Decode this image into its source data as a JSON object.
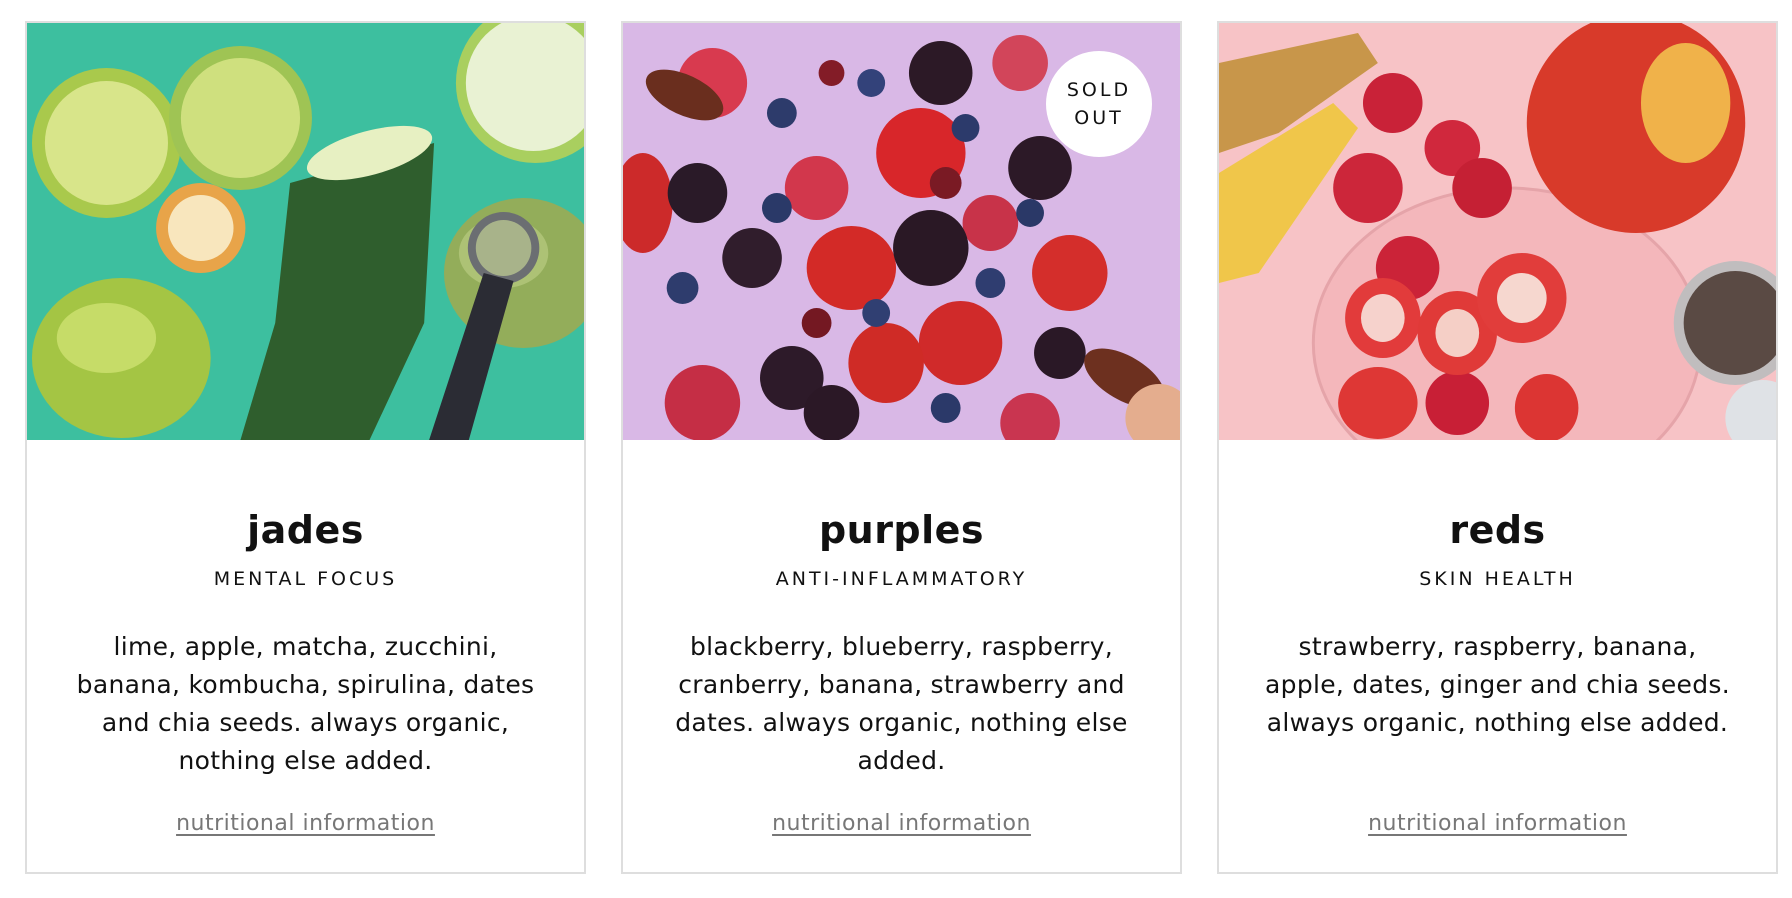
{
  "products": [
    {
      "name": "jades",
      "benefit": "MENTAL FOCUS",
      "ingredients": "lime, apple, matcha, zucchini, banana, kombucha, spirulina, dates and chia seeds. always organic, nothing else added.",
      "link": "nutritional information",
      "bg_color": "#3dbf9f"
    },
    {
      "name": "purples",
      "benefit": "ANTI-INFLAMMATORY",
      "ingredients": "blackberry, blueberry, raspberry, cranberry, banana, strawberry and dates. always organic, nothing else added.",
      "link": "nutritional information",
      "badge": "SOLD\nOUT",
      "bg_color": "#d9b8e6"
    },
    {
      "name": "reds",
      "benefit": "SKIN HEALTH",
      "ingredients": "strawberry, raspberry, banana, apple, dates, ginger and chia seeds. always organic, nothing else added.",
      "link": "nutritional information",
      "bg_color": "#f7c3c6"
    }
  ]
}
